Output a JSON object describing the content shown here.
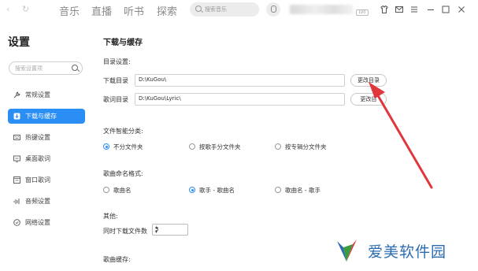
{
  "topbar": {
    "back_arrow": "‹",
    "refresh": "↻",
    "tabs": [
      "音乐",
      "直播",
      "听书",
      "探索"
    ],
    "search_placeholder": "搜索音乐",
    "vip_badge": "LV0"
  },
  "sidebar": {
    "title": "设置",
    "search_placeholder": "搜索设置项",
    "items": [
      {
        "label": "常规设置",
        "icon": "wrench-icon",
        "glyph": "⚲"
      },
      {
        "label": "下载与缓存",
        "icon": "download-icon",
        "glyph": "⬇"
      },
      {
        "label": "热键设置",
        "icon": "keyboard-icon",
        "glyph": "⌨"
      },
      {
        "label": "桌面歌词",
        "icon": "desktop-lyrics-icon",
        "glyph": "▭"
      },
      {
        "label": "窗口歌词",
        "icon": "window-lyrics-icon",
        "glyph": "▣"
      },
      {
        "label": "音频设置",
        "icon": "audio-icon",
        "glyph": "♪"
      },
      {
        "label": "网络设置",
        "icon": "network-icon",
        "glyph": "◎"
      }
    ],
    "active_index": 1
  },
  "main": {
    "title": "下载与缓存",
    "dir_section": "目录设置:",
    "download_dir_label": "下载目录",
    "download_dir_value": "D:\\KuGou\\",
    "download_dir_button": "更改目录",
    "lyric_dir_label": "歌词目录",
    "lyric_dir_value": "D:\\KuGou\\Lyric\\",
    "lyric_dir_button": "更改目",
    "classify_section": "文件智能分类:",
    "classify_options": [
      "不分文件夹",
      "按歌手分文件夹",
      "按专辑分文件夹"
    ],
    "classify_selected": 0,
    "naming_section": "歌曲命名格式:",
    "naming_options": [
      "歌曲名",
      "歌手 - 歌曲名",
      "歌曲名 - 歌手"
    ],
    "naming_selected": 1,
    "other_section": "其他:",
    "concurrent_label": "同时下载文件数",
    "concurrent_value": "3",
    "cache_section": "歌曲缓存:"
  },
  "watermark": {
    "text": "爱美软件园"
  },
  "colors": {
    "accent": "#2a8ef4",
    "arrow": "#e0373d",
    "watermark": "#2b6bb1"
  }
}
